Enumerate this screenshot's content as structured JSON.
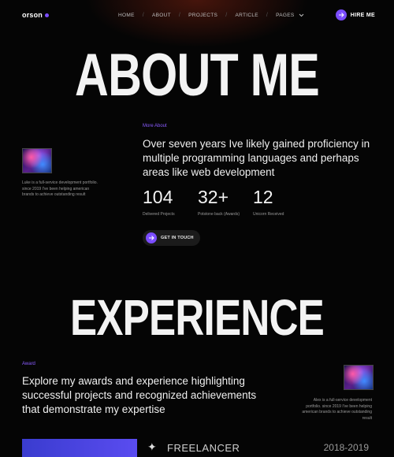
{
  "brand": {
    "name": "orson",
    "accent": "#7b4dff"
  },
  "nav": {
    "items": [
      "HOME",
      "ABOUT",
      "PROJECTS",
      "ARTICLE",
      "PAGES"
    ],
    "hire_label": "HIRE ME"
  },
  "about": {
    "heading": "ABOUT ME",
    "eyebrow": "More About",
    "lead": "Over seven years Ive likely gained proficiency in multiple programming languages and  perhaps areas like web development",
    "side_text": "Luke is a full-service development portfolio. since 2019 I've been helping american brands to achieve outstanding result",
    "stats": [
      {
        "value": "104",
        "label": "Delivered Projects"
      },
      {
        "value": "32+",
        "label": "Potstone  back  (Awards)"
      },
      {
        "value": "12",
        "label": "Unicorn Received"
      }
    ],
    "cta_label": "GET IN TOUCH"
  },
  "experience": {
    "heading": "EXPERIENCE",
    "eyebrow": "Award",
    "lead": "Explore my awards and experience highlighting successful projects and recognized achievements that demonstrate my expertise",
    "side_text": "Alex is a full-service development portfolio. since 2019 I've been helping american brands to achieve outstanding result",
    "items": [
      {
        "role": "FREELANCER",
        "years": "2018-2019"
      }
    ]
  },
  "icons": {
    "hire": "arrow-right-icon",
    "cta": "arrow-right-icon",
    "pages": "chevron-down-icon",
    "role": "sparkle-icon"
  }
}
